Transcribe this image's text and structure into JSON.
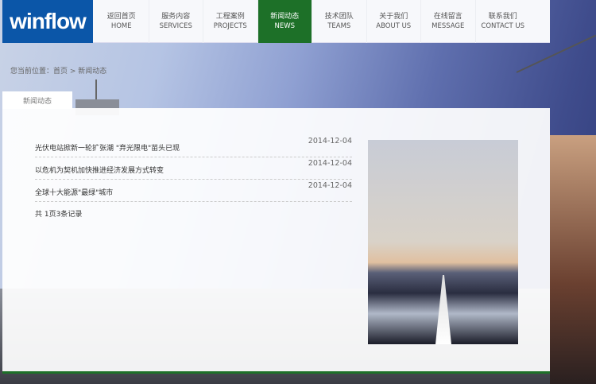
{
  "logo": "winflow",
  "nav": [
    {
      "cn": "返回首页",
      "en": "HOME"
    },
    {
      "cn": "服务内容",
      "en": "SERVICES"
    },
    {
      "cn": "工程案例",
      "en": "PROJECTS"
    },
    {
      "cn": "新闻动态",
      "en": "NEWS"
    },
    {
      "cn": "技术团队",
      "en": "TEAMS"
    },
    {
      "cn": "关于我们",
      "en": "ABOUT US"
    },
    {
      "cn": "在线留言",
      "en": "MESSAGE"
    },
    {
      "cn": "联系我们",
      "en": "CONTACT US"
    }
  ],
  "breadcrumb": {
    "prefix": "您当前位置：",
    "home": "首页",
    "sep": " > ",
    "current": "新闻动态"
  },
  "tab": "新闻动态",
  "news": [
    {
      "title": "光伏电站掀新一轮扩张潮 \"弃光限电\"苗头已现",
      "date": "2014-12-04"
    },
    {
      "title": "以危机为契机加快推进经济发展方式转变",
      "date": "2014-12-04"
    },
    {
      "title": "全球十大能源\"最绿\"城市",
      "date": "2014-12-04"
    }
  ],
  "pager": "共 1页3条记录",
  "colors": {
    "brand": "#0b56a8",
    "active": "#1d7028"
  }
}
